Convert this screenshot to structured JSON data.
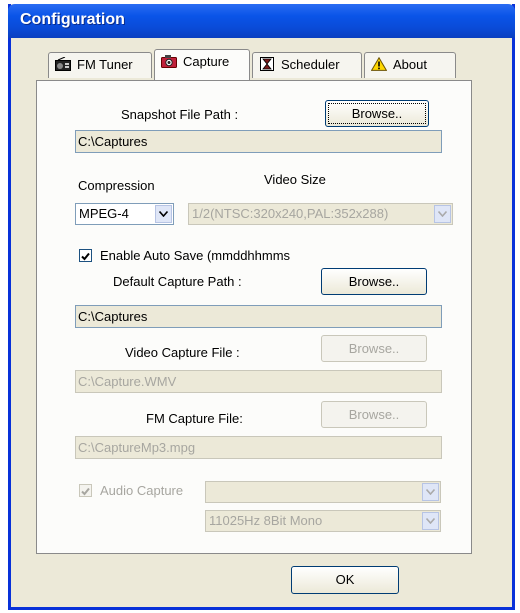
{
  "window": {
    "title": "Configuration"
  },
  "tabs": [
    {
      "label": "FM Tuner",
      "icon": "radio-icon"
    },
    {
      "label": "Capture",
      "icon": "camera-icon"
    },
    {
      "label": "Scheduler",
      "icon": "hourglass-icon"
    },
    {
      "label": "About",
      "icon": "warning-icon"
    }
  ],
  "snapshot": {
    "label": "Snapshot File Path :",
    "browse": "Browse..",
    "path": "C:\\Captures"
  },
  "compression": {
    "label": "Compression",
    "value": "MPEG-4"
  },
  "video_size": {
    "label": "Video Size",
    "value": "1/2(NTSC:320x240,PAL:352x288)"
  },
  "auto_save": {
    "label": "Enable Auto Save (mmddhhmms",
    "checked": true
  },
  "default_capture": {
    "label": "Default Capture Path :",
    "browse": "Browse..",
    "path": "C:\\Captures"
  },
  "video_capture": {
    "label": "Video Capture File :",
    "browse": "Browse..",
    "path": "C:\\Capture.WMV"
  },
  "fm_capture": {
    "label": "FM Capture File:",
    "browse": "Browse..",
    "path": "C:\\CaptureMp3.mpg"
  },
  "audio_capture": {
    "label": "Audio Capture",
    "checked": true,
    "device": "",
    "format": "11025Hz 8Bit Mono"
  },
  "ok_label": "OK"
}
